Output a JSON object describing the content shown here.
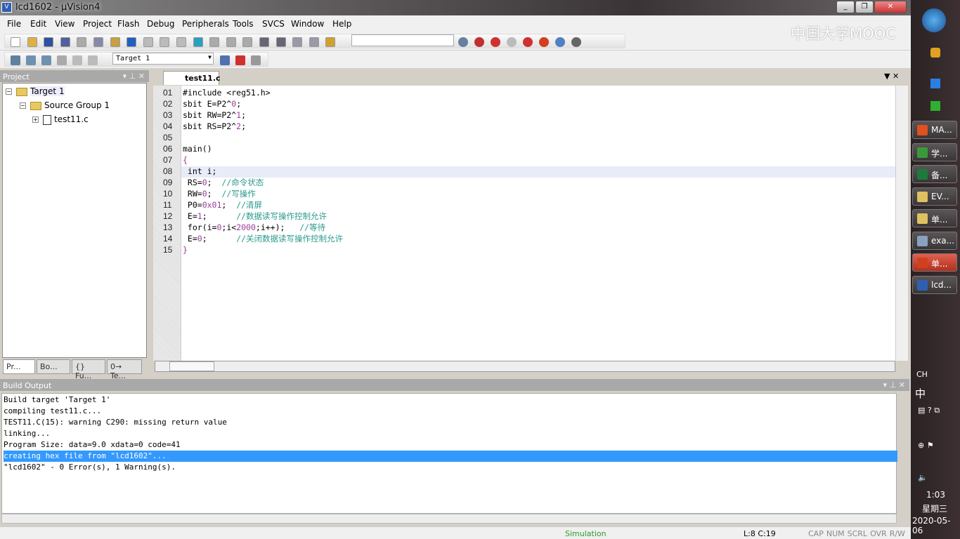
{
  "window": {
    "title": "lcd1602  - µVision4",
    "icon": "uvision-icon"
  },
  "menu": [
    "File",
    "Edit",
    "View",
    "Project",
    "Flash",
    "Debug",
    "Peripherals",
    "Tools",
    "SVCS",
    "Window",
    "Help"
  ],
  "toolbar": {
    "target_select": "Target 1",
    "find_select": ""
  },
  "watermark": "中国大学MOOC",
  "project": {
    "title": "Project",
    "tree": {
      "target": "Target 1",
      "group": "Source Group 1",
      "file": "test11.c"
    },
    "tabs": [
      "Pr...",
      "Bo...",
      "{} Fu...",
      "0→ Te..."
    ]
  },
  "editor": {
    "tab": "test11.c",
    "lines": [
      {
        "n": "01",
        "parts": [
          [
            "#include <reg51.h>",
            ""
          ]
        ]
      },
      {
        "n": "02",
        "parts": [
          [
            "sbit E=P2^",
            ""
          ],
          [
            "0",
            "num"
          ],
          [
            ";",
            ""
          ]
        ]
      },
      {
        "n": "03",
        "parts": [
          [
            "sbit RW=P2^",
            ""
          ],
          [
            "1",
            "num"
          ],
          [
            ";",
            ""
          ]
        ]
      },
      {
        "n": "04",
        "parts": [
          [
            "sbit RS=P2^",
            ""
          ],
          [
            "2",
            "num"
          ],
          [
            ";",
            ""
          ]
        ]
      },
      {
        "n": "05",
        "parts": []
      },
      {
        "n": "06",
        "parts": [
          [
            "main()",
            ""
          ]
        ]
      },
      {
        "n": "07",
        "parts": [
          [
            "{",
            "num"
          ]
        ]
      },
      {
        "n": "08",
        "parts": [
          [
            " int i;",
            ""
          ]
        ]
      },
      {
        "n": "09",
        "parts": [
          [
            " RS=",
            ""
          ],
          [
            "0",
            "num"
          ],
          [
            ";  ",
            ""
          ],
          [
            "//命令状态",
            "cmt"
          ]
        ]
      },
      {
        "n": "10",
        "parts": [
          [
            " RW=",
            ""
          ],
          [
            "0",
            "num"
          ],
          [
            ";  ",
            ""
          ],
          [
            "//写操作",
            "cmt"
          ]
        ]
      },
      {
        "n": "11",
        "parts": [
          [
            " P0=",
            ""
          ],
          [
            "0x01",
            "num"
          ],
          [
            ";  ",
            ""
          ],
          [
            "//清屏",
            "cmt"
          ]
        ]
      },
      {
        "n": "12",
        "parts": [
          [
            " E=",
            ""
          ],
          [
            "1",
            "num"
          ],
          [
            ";      ",
            ""
          ],
          [
            "//数据读写操作控制允许",
            "cmt"
          ]
        ]
      },
      {
        "n": "13",
        "parts": [
          [
            " for(i=",
            ""
          ],
          [
            "0",
            "num"
          ],
          [
            ";i<",
            ""
          ],
          [
            "2000",
            "num"
          ],
          [
            ";i++);   ",
            ""
          ],
          [
            "//等待",
            "cmt"
          ]
        ]
      },
      {
        "n": "14",
        "parts": [
          [
            " E=",
            ""
          ],
          [
            "0",
            "num"
          ],
          [
            ";      ",
            ""
          ],
          [
            "//关闭数据读写操作控制允许",
            "cmt"
          ]
        ]
      },
      {
        "n": "15",
        "parts": [
          [
            "}",
            "num"
          ]
        ]
      }
    ],
    "current_line": 8
  },
  "build": {
    "title": "Build Output",
    "lines": [
      "Build target 'Target 1'",
      "compiling test11.c...",
      "TEST11.C(15): warning C290: missing return value",
      "linking...",
      "Program Size: data=9.0 xdata=0 code=41",
      "creating hex file from \"lcd1602\"...",
      "\"lcd1602\" - 0 Error(s), 1 Warning(s)."
    ],
    "selected": 5
  },
  "status": {
    "mode": "Simulation",
    "position": "L:8 C:19",
    "indicators": [
      "CAP",
      "NUM",
      "SCRL",
      "OVR",
      "R/W"
    ],
    "mode_color": "#2a9a2a"
  },
  "taskbar": {
    "tasks": [
      {
        "label": "MA...",
        "color": "#e05020"
      },
      {
        "label": "学...",
        "color": "#3a9a3a"
      },
      {
        "label": "备...",
        "color": "#1d7a3a"
      },
      {
        "label": "EV...",
        "color": "#e0c060"
      },
      {
        "label": "单...",
        "color": "#e0c060"
      },
      {
        "label": "exa...",
        "color": "#8aa0c0"
      },
      {
        "label": "单...",
        "color": "#d04020"
      },
      {
        "label": "lcd...",
        "color": "#2f5fb0"
      }
    ],
    "active": 6,
    "lang": "CH",
    "ime": "中",
    "time": "1:03",
    "weekday": "星期三",
    "date": "2020-05-06"
  }
}
